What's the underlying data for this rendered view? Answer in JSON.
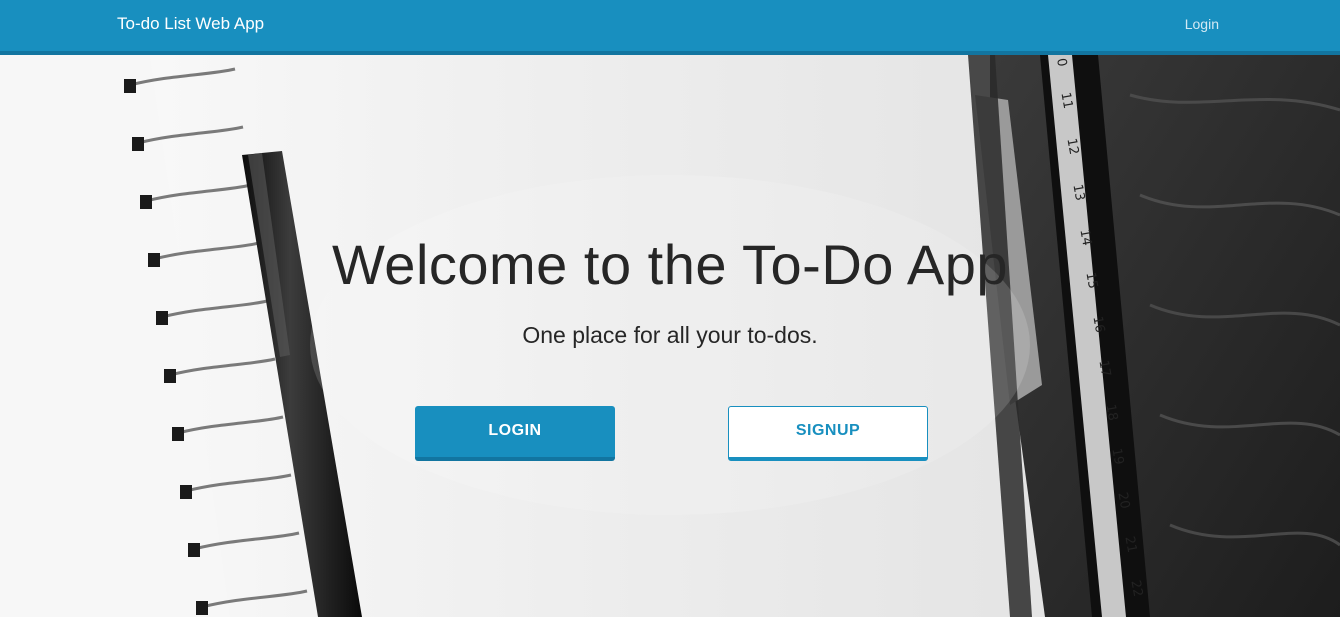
{
  "navbar": {
    "brand": "To-do List Web App",
    "login_link": "Login",
    "color": "#188fbf"
  },
  "hero": {
    "title": "Welcome to the To-Do App",
    "subtitle": "One place for all your to-dos.",
    "login_button": "LOGIN",
    "signup_button": "SIGNUP",
    "accent_color": "#188fbf"
  },
  "ruler": {
    "ticks": [
      "0",
      "11",
      "12",
      "13",
      "14",
      "15",
      "16",
      "17",
      "18",
      "19",
      "20",
      "21",
      "22"
    ]
  }
}
